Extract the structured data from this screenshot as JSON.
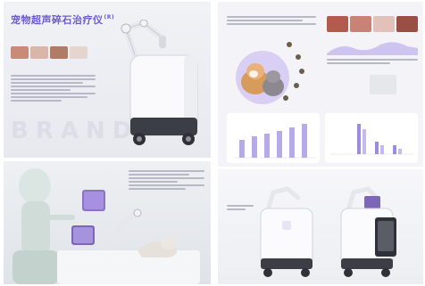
{
  "top_left": {
    "title": "宠物超声碎石治疗仪",
    "title_badge": "(R)",
    "brand_watermark": "BRAND"
  }
}
